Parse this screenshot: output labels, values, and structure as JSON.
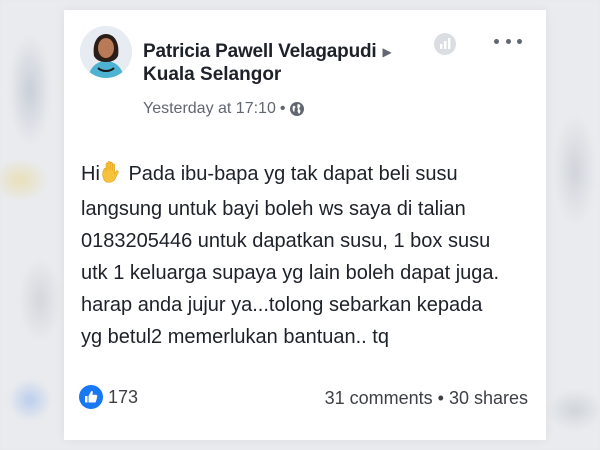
{
  "post": {
    "author": "Patricia Pawell Velagapudi",
    "location": "Kuala Selangor",
    "timestamp": "Yesterday at 17:10",
    "separator": "•",
    "privacy_icon": "globe-icon",
    "text_before_emoji": "Hi",
    "emoji": "raised-hand-emoji",
    "text": " Pada ibu-bapa yg tak dapat beli susu\nlangsung untuk bayi boleh ws saya di talian\n0183205446 untuk dapatkan susu, 1 box susu\nutk 1 keluarga supaya yg lain boleh dapat juga.\nharap anda jujur ya...tolong sebarkan kepada\nyg betul2 memerlukan bantuan.. tq"
  },
  "footer": {
    "reaction_icon": "like-icon",
    "reaction_count": "173",
    "comments": "31 comments",
    "separator": "•",
    "shares": "30 shares"
  },
  "colors": {
    "accent": "#1877f2",
    "text": "#1d2129",
    "muted": "#616770"
  }
}
